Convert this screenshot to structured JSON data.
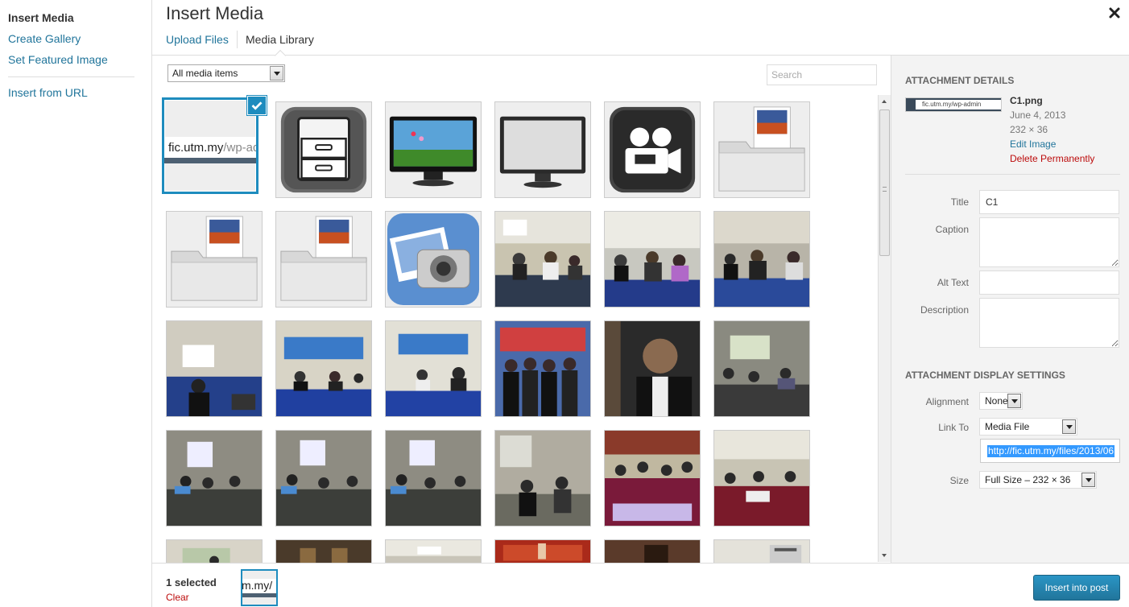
{
  "menu": {
    "items": [
      {
        "label": "Insert Media"
      },
      {
        "label": "Create Gallery"
      },
      {
        "label": "Set Featured Image"
      },
      {
        "label": "Insert from URL"
      }
    ]
  },
  "header": {
    "title": "Insert Media",
    "close_icon": "close-icon"
  },
  "router": {
    "tabs": [
      {
        "label": "Upload Files"
      },
      {
        "label": "Media Library"
      }
    ]
  },
  "toolbar": {
    "filter": {
      "selected": "All media items"
    },
    "search": {
      "placeholder": "Search",
      "value": ""
    }
  },
  "grid": {
    "selected_tile_text": "fic.utm.my",
    "selected_tile_text_dim": "/wp-ad",
    "rows": [
      [
        "url-thumbnail",
        "file-cabinet-icon",
        "monitor-landscape-icon",
        "monitor-blank-icon",
        "video-camera-icon",
        "photo-folder-icon"
      ],
      [
        "photo-folder-icon",
        "photo-folder-icon",
        "photo-camera-app-icon",
        "meeting-photo",
        "meeting-photo",
        "meeting-photo"
      ],
      [
        "meeting-photo",
        "meeting-photo",
        "meeting-photo",
        "group-photo",
        "portrait-photo",
        "meeting-photo"
      ],
      [
        "meeting-photo",
        "meeting-photo",
        "meeting-photo",
        "meeting-photo",
        "banquet-photo",
        "meeting-photo"
      ],
      [
        "meeting-photo",
        "meeting-photo",
        "meeting-photo",
        "meeting-photo",
        "meeting-photo",
        "meeting-photo"
      ]
    ]
  },
  "attachment_details": {
    "heading": "Attachment Details",
    "thumb_text": "fic.utm.my/wp-admin",
    "filename": "C1.png",
    "date": "June 4, 2013",
    "dimensions": "232 × 36",
    "edit_link": "Edit Image",
    "delete_link": "Delete Permanently",
    "fields": {
      "title": {
        "label": "Title",
        "value": "C1"
      },
      "caption": {
        "label": "Caption",
        "value": ""
      },
      "alt_text": {
        "label": "Alt Text",
        "value": ""
      },
      "description": {
        "label": "Description",
        "value": ""
      }
    }
  },
  "display_settings": {
    "heading": "Attachment Display Settings",
    "alignment": {
      "label": "Alignment",
      "value": "None"
    },
    "link_to": {
      "label": "Link To",
      "value": "Media File"
    },
    "link_url": "http://fic.utm.my/files/2013/06",
    "size": {
      "label": "Size",
      "value": "Full Size – 232 × 36"
    }
  },
  "bottom": {
    "selected_count": "1 selected",
    "clear_label": "Clear",
    "mini_text": "m.my/",
    "insert_label": "Insert into post"
  },
  "colors": {
    "accent": "#1e8cbe",
    "link": "#21759b",
    "danger": "#bc0b0b",
    "button": "#21759b"
  }
}
